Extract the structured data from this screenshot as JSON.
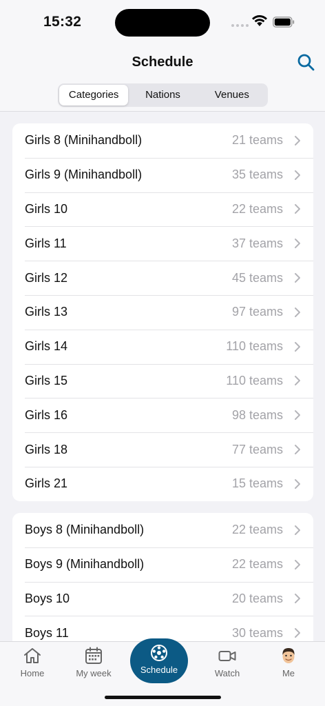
{
  "status_bar": {
    "time": "15:32"
  },
  "header": {
    "title": "Schedule",
    "segments": [
      {
        "label": "Categories",
        "active": true
      },
      {
        "label": "Nations",
        "active": false
      },
      {
        "label": "Venues",
        "active": false
      }
    ]
  },
  "groups": [
    {
      "rows": [
        {
          "label": "Girls 8 (Minihandboll)",
          "count": "21 teams"
        },
        {
          "label": "Girls 9 (Minihandboll)",
          "count": "35 teams"
        },
        {
          "label": "Girls 10",
          "count": "22 teams"
        },
        {
          "label": "Girls 11",
          "count": "37 teams"
        },
        {
          "label": "Girls 12",
          "count": "45 teams"
        },
        {
          "label": "Girls 13",
          "count": "97 teams"
        },
        {
          "label": "Girls 14",
          "count": "110 teams"
        },
        {
          "label": "Girls 15",
          "count": "110 teams"
        },
        {
          "label": "Girls 16",
          "count": "98 teams"
        },
        {
          "label": "Girls 18",
          "count": "77 teams"
        },
        {
          "label": "Girls 21",
          "count": "15 teams"
        }
      ]
    },
    {
      "rows": [
        {
          "label": "Boys 8 (Minihandboll)",
          "count": "22 teams"
        },
        {
          "label": "Boys 9 (Minihandboll)",
          "count": "22 teams"
        },
        {
          "label": "Boys 10",
          "count": "20 teams"
        },
        {
          "label": "Boys 11",
          "count": "30 teams"
        }
      ]
    }
  ],
  "tabbar": {
    "home": "Home",
    "week": "My week",
    "schedule": "Schedule",
    "watch": "Watch",
    "me": "Me"
  },
  "colors": {
    "accent": "#0c5a85",
    "icon_blue": "#0a6aa1",
    "muted": "#a3a3a8"
  }
}
